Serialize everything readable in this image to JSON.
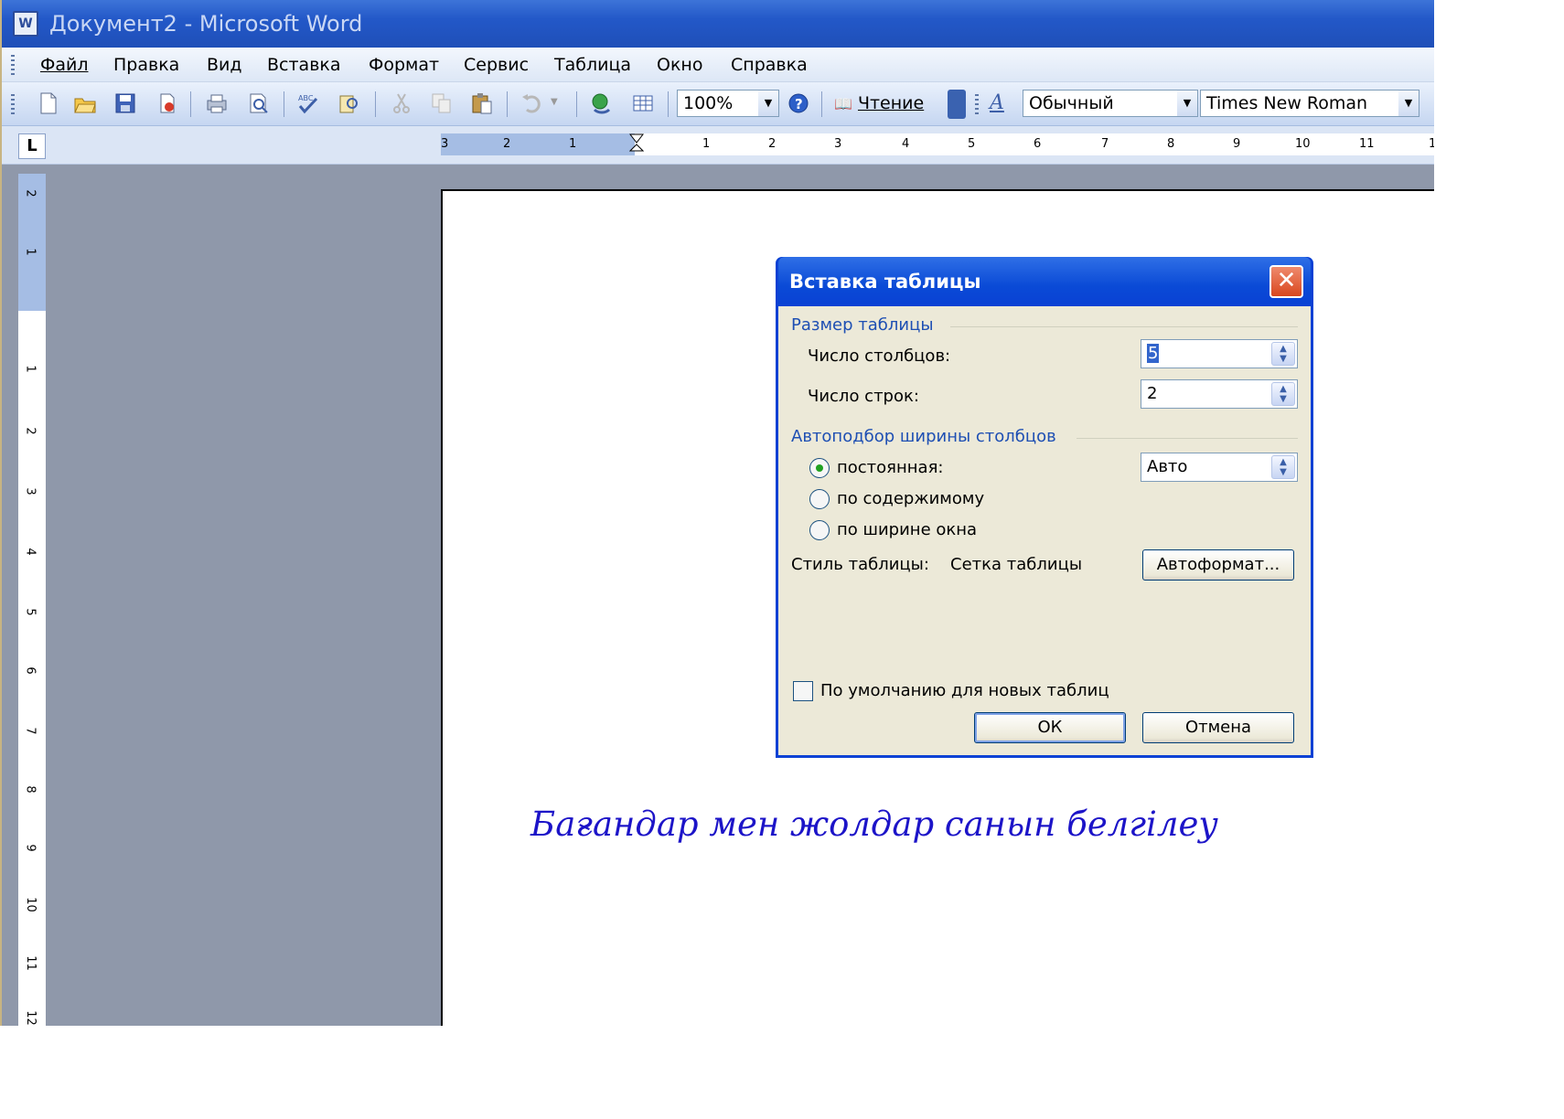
{
  "window": {
    "title": "Документ2 - Microsoft Word"
  },
  "menu": [
    "Файл",
    "Правка",
    "Вид",
    "Вставка",
    "Формат",
    "Сервис",
    "Таблица",
    "Окно",
    "Справка"
  ],
  "toolbar": {
    "zoom": "100%",
    "read_label": "Чтение",
    "style": "Обычный",
    "font": "Times New Roman",
    "icons": [
      "new-document-icon",
      "open-folder-icon",
      "save-icon",
      "permission-icon",
      "print-icon",
      "print-preview-icon",
      "spelling-icon",
      "research-icon",
      "cut-icon",
      "copy-icon",
      "paste-icon",
      "undo-icon",
      "hyperlink-icon",
      "insert-table-icon",
      "help-icon",
      "read-icon",
      "styles-icon"
    ]
  },
  "ruler": {
    "horizontal": [
      "3",
      "2",
      "1",
      "1",
      "2",
      "3",
      "4",
      "5",
      "6",
      "7",
      "8",
      "9",
      "10",
      "11",
      "1"
    ],
    "vertical": [
      "2",
      "1",
      "1",
      "2",
      "3",
      "4",
      "5",
      "6",
      "7",
      "8",
      "9",
      "10",
      "11",
      "12"
    ]
  },
  "dialog": {
    "title": "Вставка таблицы",
    "size_group": "Размер таблицы",
    "columns_label": "Число столбцов:",
    "columns_value": "5",
    "rows_label": "Число строк:",
    "rows_value": "2",
    "autofit_group": "Автоподбор ширины столбцов",
    "radio_fixed": "постоянная:",
    "fixed_value": "Авто",
    "radio_contents": "по содержимому",
    "radio_window": "по ширине окна",
    "style_label": "Стиль таблицы:",
    "style_value": "Сетка таблицы",
    "autoformat_button": "Автоформат...",
    "default_checkbox": "По умолчанию для новых таблиц",
    "ok_button": "ОК",
    "cancel_button": "Отмена"
  },
  "caption": "Бағандар мен жолдар санын белгілеу"
}
